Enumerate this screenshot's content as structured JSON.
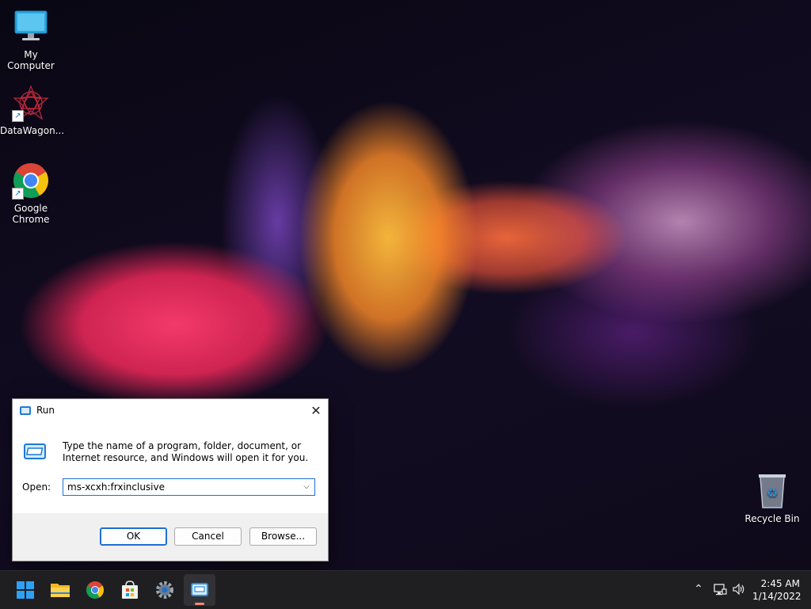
{
  "desktop": {
    "icons": [
      {
        "label": "My Computer",
        "icon": "monitor-icon"
      },
      {
        "label": "DataWagon...",
        "icon": "datawagon-app-icon",
        "shortcut": true
      },
      {
        "label": "Google Chrome",
        "icon": "chrome-icon",
        "shortcut": true
      },
      {
        "label": "Recycle Bin",
        "icon": "recycle-bin-icon"
      }
    ]
  },
  "run_dialog": {
    "title": "Run",
    "description": "Type the name of a program, folder, document, or Internet resource, and Windows will open it for you.",
    "open_label": "Open:",
    "open_value": "ms-xcxh:frxinclusive",
    "buttons": {
      "ok": "OK",
      "cancel": "Cancel",
      "browse": "Browse..."
    }
  },
  "taskbar": {
    "apps": [
      {
        "name": "start",
        "icon": "windows-start-icon"
      },
      {
        "name": "file-explorer",
        "icon": "folder-icon"
      },
      {
        "name": "chrome",
        "icon": "chrome-icon"
      },
      {
        "name": "store",
        "icon": "store-bag-icon"
      },
      {
        "name": "settings",
        "icon": "gear-icon"
      },
      {
        "name": "run",
        "icon": "run-app-icon",
        "active": true
      }
    ],
    "tray": {
      "time": "2:45 AM",
      "date": "1/14/2022"
    }
  },
  "colors": {
    "accent": "#1f6fd1",
    "taskbar": "#1f1f21",
    "active_indicator": "#f08a7a"
  }
}
